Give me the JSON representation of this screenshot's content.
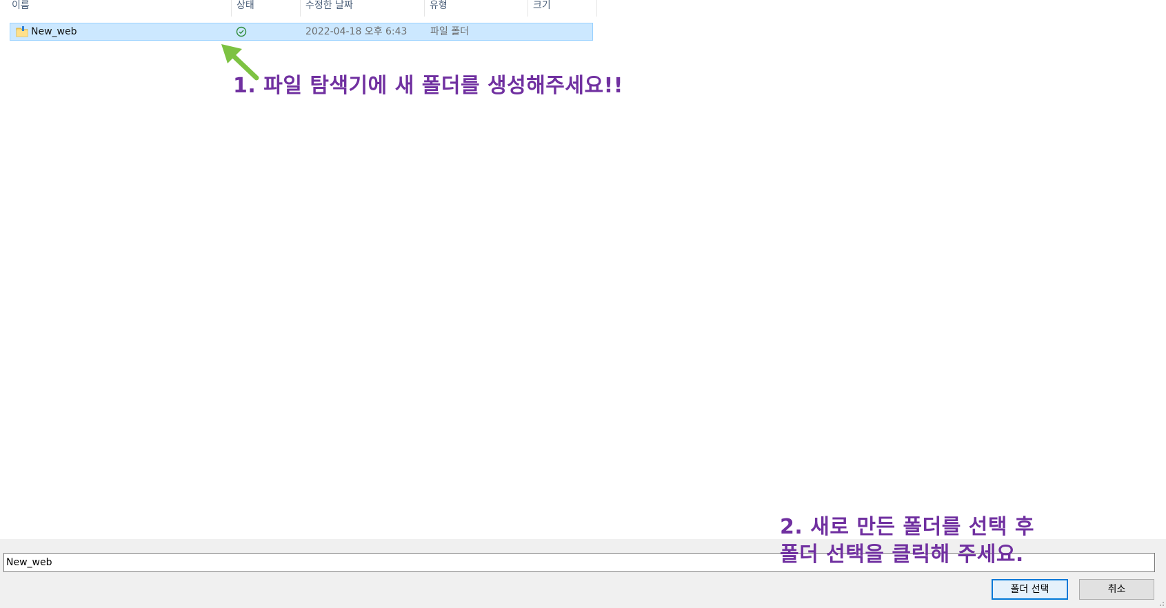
{
  "columns": {
    "name": "이름",
    "status": "상태",
    "date": "수정한 날짜",
    "type": "유형",
    "size": "크기"
  },
  "files": [
    {
      "name": "New_web",
      "status_icon": "check-circle-icon",
      "modified": "2022-04-18 오후 6:43",
      "type": "파일 폴더",
      "size": ""
    }
  ],
  "annotations": {
    "step1": "1. 파일 탐색기에 새 폴더를 생성해주세요!!",
    "step2_line1": "2. 새로 만든 폴더를 선택 후",
    "step2_line2": "폴더 선택을 클릭해 주세요."
  },
  "footer": {
    "filename_value": "New_web",
    "select_button": "폴더 선택",
    "cancel_button": "취소"
  },
  "colors": {
    "annotation_text": "#7030a0",
    "annotation_arrow": "#7dc242",
    "selection_bg": "#cce8ff",
    "selection_border": "#99d1ff",
    "primary_button_border": "#0078d7"
  }
}
